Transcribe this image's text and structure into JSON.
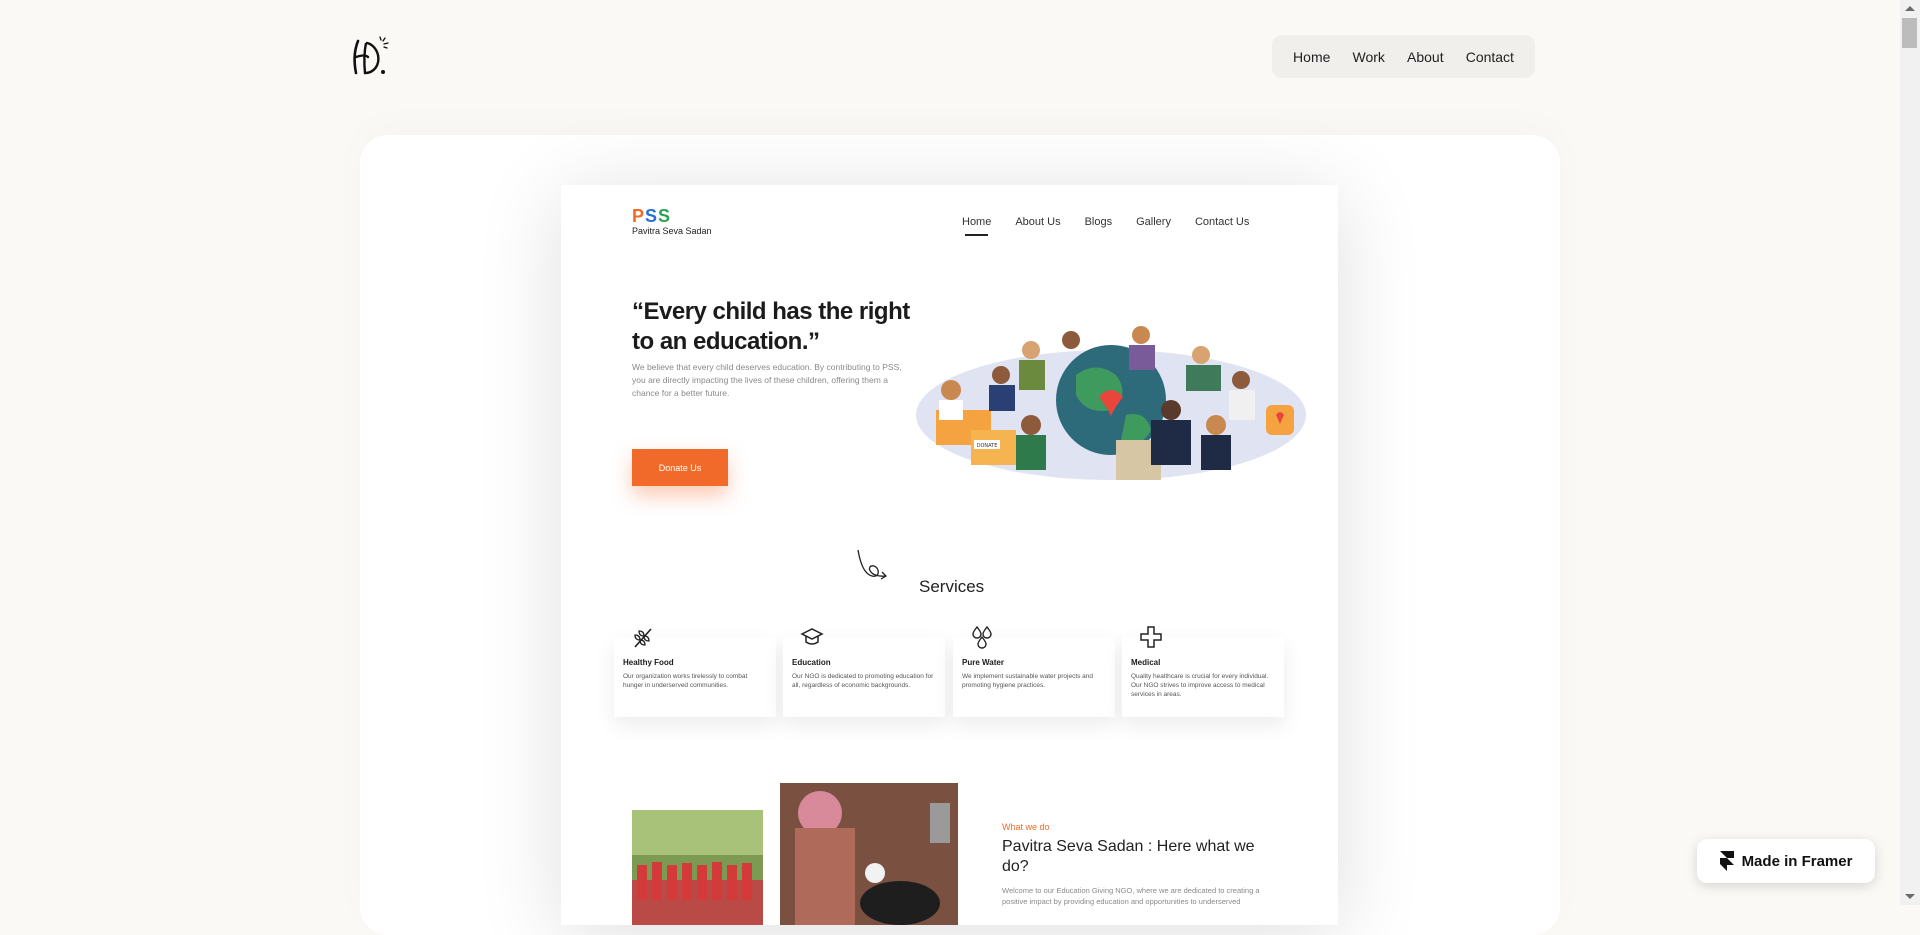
{
  "site": {
    "logo_alt": "H. logo",
    "nav": [
      "Home",
      "Work",
      "About",
      "Contact"
    ]
  },
  "mock": {
    "logo_letters": [
      "P",
      "S",
      "S"
    ],
    "logo_sub": "Pavitra Seva Sadan",
    "nav": [
      {
        "label": "Home",
        "active": true
      },
      {
        "label": "About Us",
        "active": false
      },
      {
        "label": "Blogs",
        "active": false
      },
      {
        "label": "Gallery",
        "active": false
      },
      {
        "label": "Contact Us",
        "active": false
      }
    ],
    "hero": {
      "title": "“Every child has the right to an education.”",
      "desc": "We believe that every child deserves education. By contributing to PSS, you are directly impacting the lives of these children, offering them a chance for a better future.",
      "cta": "Donate Us",
      "illustration_box_label": "DONATE"
    },
    "services": {
      "title": "Services",
      "items": [
        {
          "icon": "wheat-icon",
          "name": "Healthy Food",
          "text": "Our organization works tirelessly to combat hunger in underserved communities."
        },
        {
          "icon": "graduation-cap-icon",
          "name": "Education",
          "text": "Our NGO is dedicated to promoting education for all, regardless of economic backgrounds."
        },
        {
          "icon": "water-drops-icon",
          "name": "Pure Water",
          "text": "We implement sustainable water projects and promoting hygiene practices."
        },
        {
          "icon": "medical-cross-icon",
          "name": "Medical",
          "text": "Quality healthcare is crucial for every individual. Our NGO strives to improve access to medical services in areas."
        }
      ]
    },
    "what_we_do": {
      "label": "What we do",
      "title": "Pavitra Seva Sadan : Here what we do?",
      "desc": "Welcome to our Education Giving NGO, where we are dedicated to creating a positive impact by providing education and opportunities to underserved"
    }
  },
  "badge": {
    "label": "Made in Framer"
  },
  "colors": {
    "accent": "#f26a2a",
    "page_bg": "#fbf9f5",
    "nav_bg": "#f1efeb"
  }
}
